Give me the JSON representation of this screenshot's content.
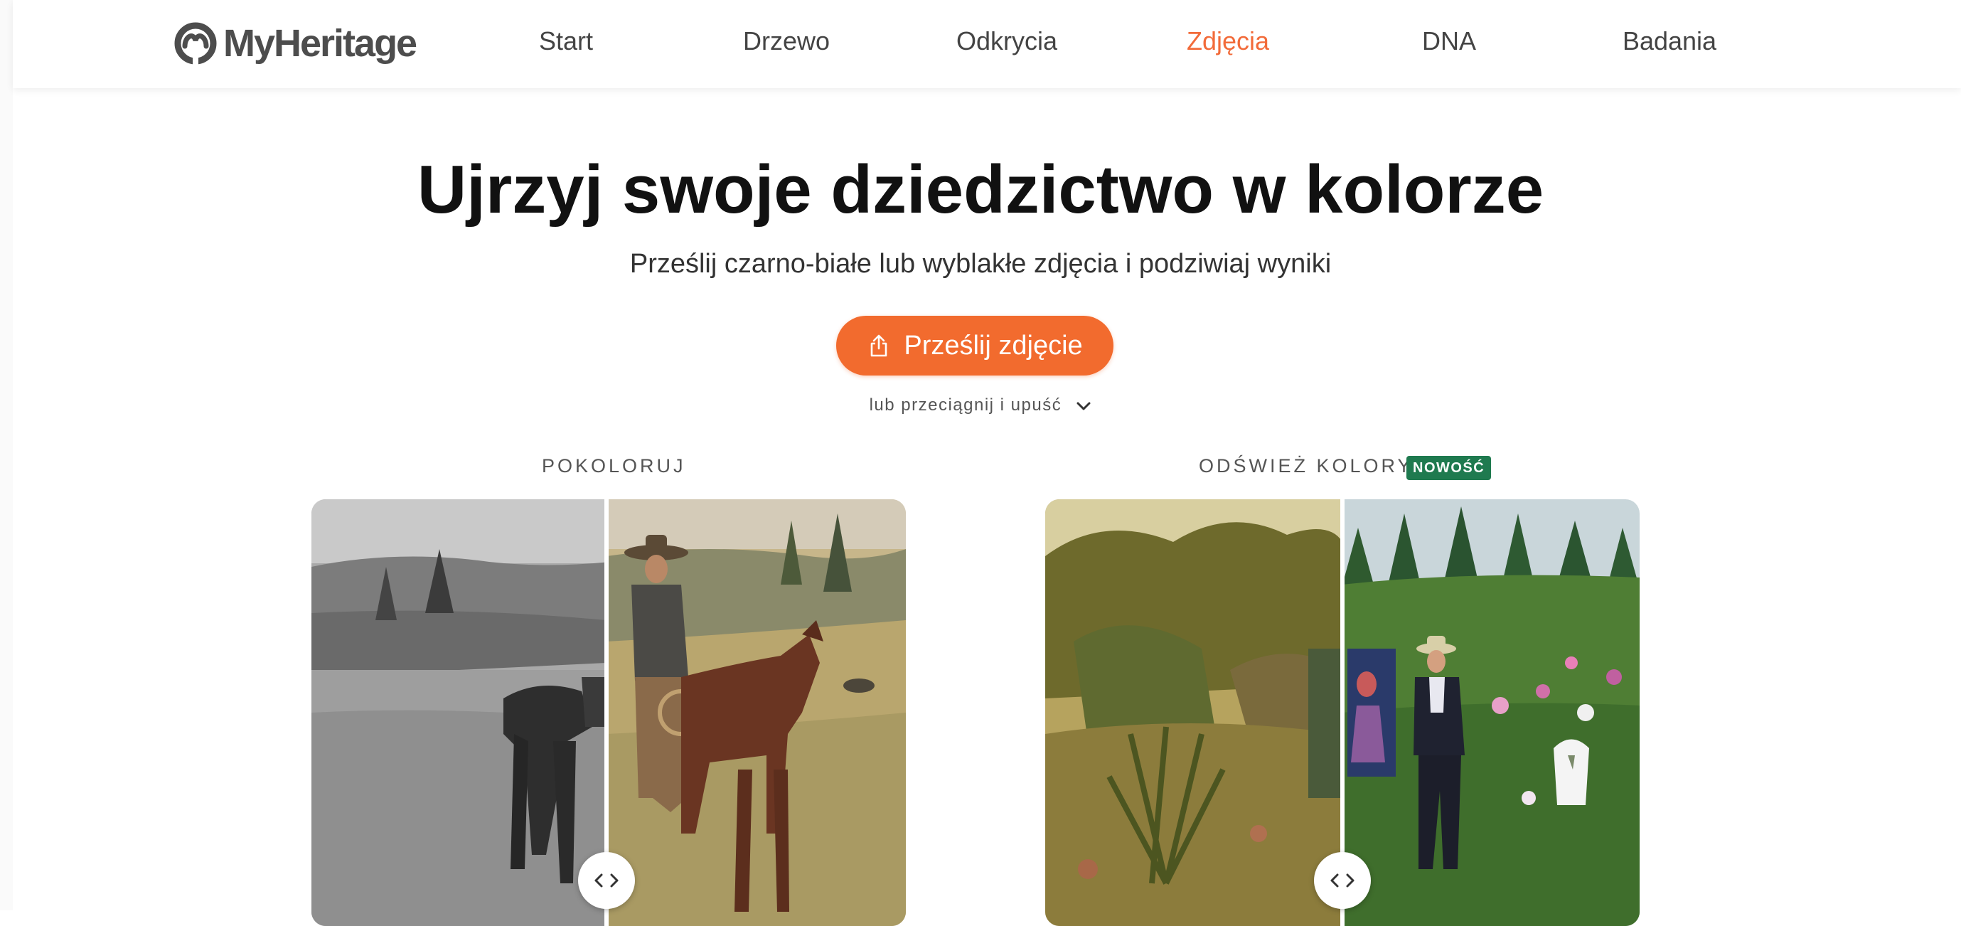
{
  "brand": {
    "name": "MyHeritage"
  },
  "nav": {
    "items": [
      {
        "label": "Start"
      },
      {
        "label": "Drzewo"
      },
      {
        "label": "Odkrycia"
      },
      {
        "label": "Zdjęcia",
        "active": true
      },
      {
        "label": "DNA"
      },
      {
        "label": "Badania"
      }
    ]
  },
  "hero": {
    "title": "Ujrzyj swoje dziedzictwo w kolorze",
    "subtitle": "Prześlij czarno-białe lub wyblakłe zdjęcia i podziwiaj wyniki",
    "upload_label": "Prześlij zdjęcie",
    "drag_hint": "lub przeciągnij i upuść"
  },
  "sections": {
    "colorize": {
      "label": "POKOLORUJ"
    },
    "restore": {
      "label": "ODŚWIEŻ KOLORY",
      "badge": "NOWOŚĆ"
    }
  },
  "icons": {
    "logo": "myheritage-logo-icon",
    "upload": "share-upload-icon",
    "dropdown": "chevron-down-icon",
    "compare_handle": "left-right-arrows-icon"
  },
  "colors": {
    "accent": "#f26b2e",
    "active_nav": "#f26b3a",
    "badge_green": "#1f7a4f",
    "text_dark": "#111111"
  }
}
